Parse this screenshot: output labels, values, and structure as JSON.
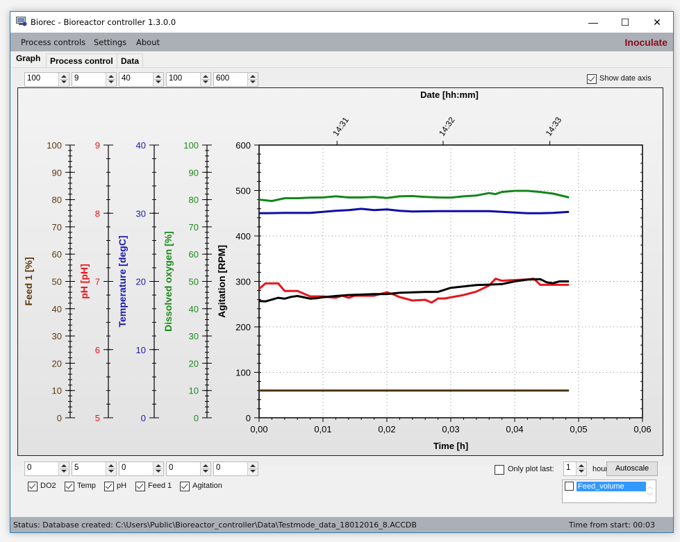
{
  "window": {
    "title": "Biorec - Bioreactor controller 1.3.0.0",
    "minimize_glyph": "—",
    "maximize_glyph": "☐",
    "close_glyph": "✕"
  },
  "menu": {
    "items": [
      "Process controls",
      "Settings",
      "About"
    ],
    "action_label": "Inoculate"
  },
  "tabs": [
    "Graph",
    "Process control",
    "Data"
  ],
  "top_spinners": [
    "100",
    "9",
    "40",
    "100",
    "600"
  ],
  "show_date_axis": {
    "label": "Show date axis",
    "checked": true
  },
  "bottom_spinners": [
    "0",
    "5",
    "0",
    "0",
    "0"
  ],
  "series_toggles": [
    {
      "label": "DO2",
      "checked": true
    },
    {
      "label": "Temp",
      "checked": true
    },
    {
      "label": "pH",
      "checked": true
    },
    {
      "label": "Feed 1",
      "checked": true
    },
    {
      "label": "Agitation",
      "checked": true
    }
  ],
  "only_plot_last": {
    "label": "Only plot last:",
    "checked": false,
    "value": "1",
    "unit": "hours"
  },
  "autoscale_label": "Autoscale",
  "extra_series_list": [
    {
      "label": "Feed_volume",
      "checked": false,
      "selected": true
    }
  ],
  "status": {
    "text": "Status: Database created: C:\\Users\\Public\\Bioreactor_controller\\Data\\Testmode_data_18012016_8.ACCDB",
    "time_from_start": "Time from start: 00:03"
  },
  "chart_data": {
    "type": "line",
    "title": "",
    "xlabel": "Time [h]",
    "x2label": "Date [hh:mm]",
    "xlim": [
      0,
      0.06
    ],
    "x_ticks": [
      "0,00",
      "0,01",
      "0,02",
      "0,03",
      "0,04",
      "0,05",
      "0,06"
    ],
    "date_ticks": [
      {
        "label": "14:31",
        "x": 0.0122
      },
      {
        "label": "14:32",
        "x": 0.0288
      },
      {
        "label": "14:33",
        "x": 0.0455
      }
    ],
    "grid": true,
    "axes": [
      {
        "key": "feed",
        "label": "Feed 1 [%]",
        "color": "#5c3a0e",
        "ylim": [
          0,
          100
        ],
        "ticks": [
          "0",
          "10",
          "20",
          "30",
          "40",
          "50",
          "60",
          "70",
          "80",
          "90",
          "100"
        ]
      },
      {
        "key": "ph",
        "label": "pH [pH]",
        "color": "#e8141c",
        "ylim": [
          5,
          9
        ],
        "ticks": [
          "5",
          "6",
          "7",
          "8",
          "9"
        ]
      },
      {
        "key": "temp",
        "label": "Temperature [degC]",
        "color": "#1a1ab0",
        "ylim": [
          0,
          40
        ],
        "ticks": [
          "0",
          "10",
          "20",
          "30",
          "40"
        ]
      },
      {
        "key": "do2",
        "label": "Dissolved oxygen [%]",
        "color": "#1a8c1a",
        "ylim": [
          0,
          100
        ],
        "ticks": [
          "0",
          "10",
          "20",
          "30",
          "40",
          "50",
          "60",
          "70",
          "80",
          "90",
          "100"
        ]
      },
      {
        "key": "agit",
        "label": "Agitation [RPM]",
        "color": "#000000",
        "ylim": [
          0,
          600
        ],
        "ticks": [
          "0",
          "100",
          "200",
          "300",
          "400",
          "500",
          "600"
        ]
      }
    ],
    "series": [
      {
        "name": "DO2",
        "axis": "do2",
        "color": "#13861a",
        "x": [
          0,
          0.002,
          0.004,
          0.006,
          0.008,
          0.01,
          0.012,
          0.014,
          0.016,
          0.018,
          0.02,
          0.022,
          0.024,
          0.026,
          0.028,
          0.03,
          0.032,
          0.034,
          0.036,
          0.037,
          0.038,
          0.04,
          0.042,
          0.044,
          0.046,
          0.0485
        ],
        "y": [
          80,
          79.5,
          80.5,
          80.5,
          80.7,
          80.8,
          81.2,
          80.8,
          80.8,
          81,
          80.6,
          81.2,
          81.3,
          81,
          80.8,
          80.7,
          81.2,
          81.5,
          82.4,
          82,
          82.8,
          83.2,
          83.2,
          82.8,
          82.2,
          80.8
        ]
      },
      {
        "name": "Temp",
        "axis": "temp",
        "color": "#0d0da8",
        "x": [
          0,
          0.004,
          0.008,
          0.01,
          0.012,
          0.014,
          0.016,
          0.018,
          0.02,
          0.022,
          0.024,
          0.028,
          0.032,
          0.036,
          0.038,
          0.04,
          0.042,
          0.044,
          0.046,
          0.0485
        ],
        "y": [
          30,
          30.05,
          30.05,
          30.2,
          30.35,
          30.45,
          30.65,
          30.45,
          30.55,
          30.35,
          30.25,
          30.3,
          30.3,
          30.3,
          30.2,
          30.1,
          30,
          30,
          30.05,
          30.2
        ]
      },
      {
        "name": "pH",
        "axis": "ph",
        "color": "#e8141c",
        "x": [
          0,
          0.001,
          0.003,
          0.004,
          0.006,
          0.008,
          0.01,
          0.012,
          0.013,
          0.014,
          0.015,
          0.016,
          0.018,
          0.02,
          0.021,
          0.022,
          0.024,
          0.026,
          0.027,
          0.028,
          0.029,
          0.032,
          0.034,
          0.036,
          0.037,
          0.038,
          0.04,
          0.042,
          0.043,
          0.044,
          0.046,
          0.0485
        ],
        "y": [
          6.89,
          6.97,
          6.97,
          6.86,
          6.86,
          6.78,
          6.78,
          6.76,
          6.79,
          6.76,
          6.79,
          6.79,
          6.79,
          6.84,
          6.81,
          6.77,
          6.72,
          6.73,
          6.69,
          6.75,
          6.75,
          6.8,
          6.85,
          6.94,
          7.04,
          7.01,
          7.02,
          7.03,
          7.04,
          6.95,
          6.95,
          6.95
        ]
      },
      {
        "name": "Agitation",
        "axis": "agit",
        "color": "#000000",
        "x": [
          0,
          0.001,
          0.002,
          0.003,
          0.004,
          0.005,
          0.006,
          0.007,
          0.008,
          0.009,
          0.01,
          0.012,
          0.014,
          0.016,
          0.018,
          0.02,
          0.022,
          0.024,
          0.026,
          0.028,
          0.03,
          0.032,
          0.034,
          0.036,
          0.038,
          0.04,
          0.042,
          0.044,
          0.045,
          0.046,
          0.047,
          0.0485
        ],
        "y": [
          257,
          256,
          260,
          264,
          262,
          266,
          268,
          265,
          262,
          263,
          265,
          268,
          270,
          271,
          272,
          272,
          275,
          276,
          277,
          277,
          286,
          289,
          292,
          293,
          294,
          300,
          304,
          305,
          298,
          296,
          300,
          300
        ]
      },
      {
        "name": "Feed 1",
        "axis": "feed",
        "color": "#4a3210",
        "x": [
          0,
          0.0485
        ],
        "y": [
          10,
          10
        ]
      }
    ]
  }
}
